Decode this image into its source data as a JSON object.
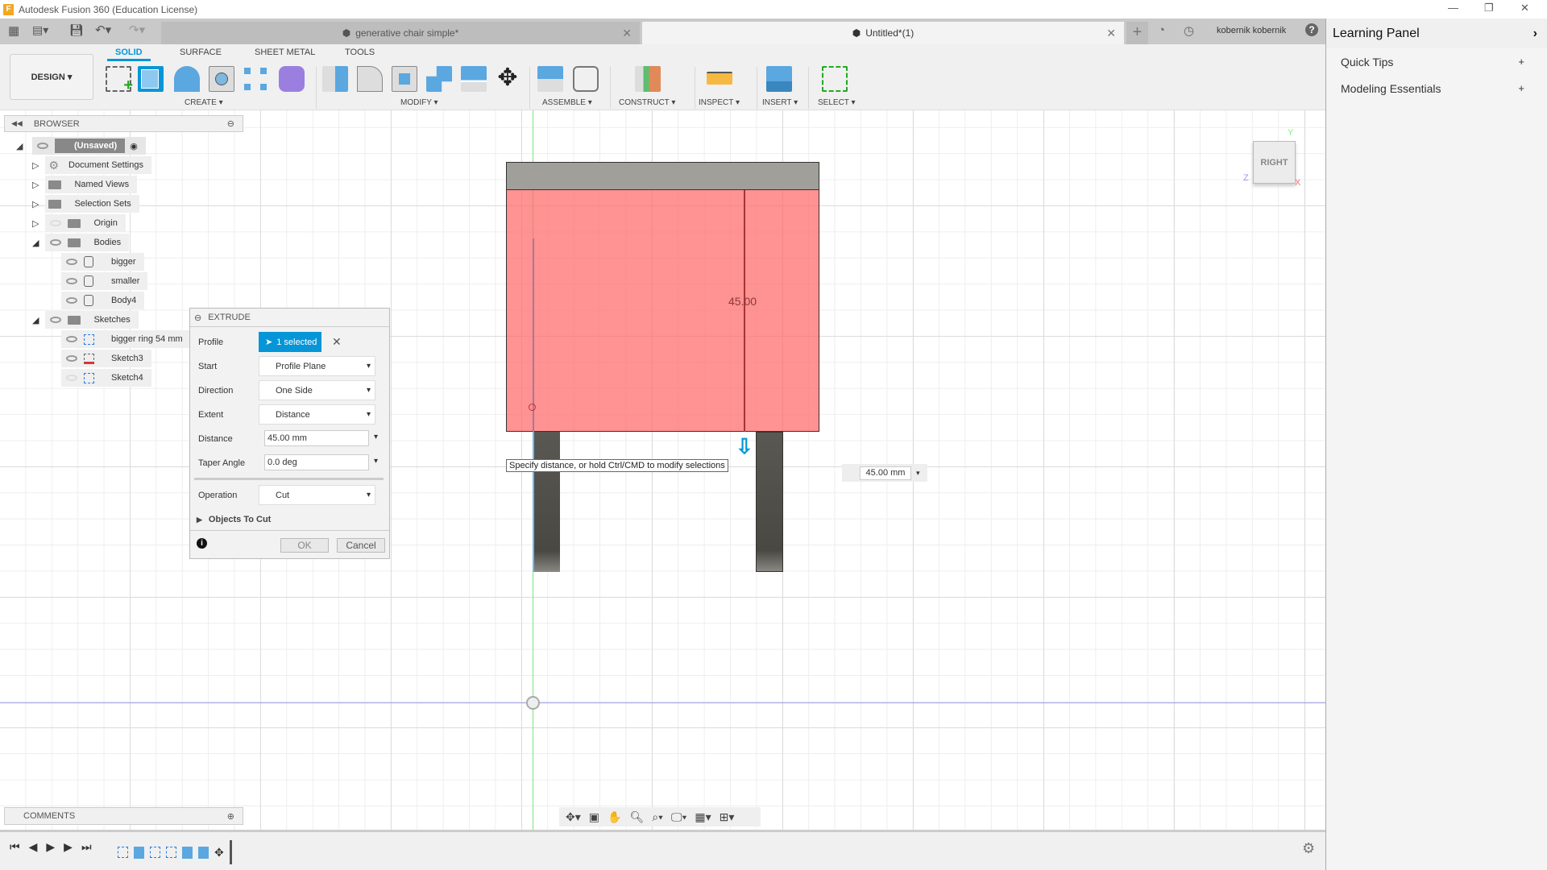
{
  "app": {
    "title": "Autodesk Fusion 360 (Education License)",
    "logo": "F"
  },
  "tabs": [
    {
      "label": "generative chair simple*",
      "active": false
    },
    {
      "label": "Untitled*(1)",
      "active": true
    }
  ],
  "user": {
    "name": "kobernik kobernik"
  },
  "toolbar": {
    "workspace": "DESIGN ▾",
    "tabs": [
      "SOLID",
      "SURFACE",
      "SHEET METAL",
      "TOOLS"
    ],
    "groups": [
      "CREATE ▾",
      "MODIFY ▾",
      "ASSEMBLE ▾",
      "CONSTRUCT ▾",
      "INSPECT ▾",
      "INSERT ▾",
      "SELECT ▾"
    ]
  },
  "browser": {
    "title": "BROWSER",
    "root": "(Unsaved)",
    "items": [
      "Document Settings",
      "Named Views",
      "Selection Sets",
      "Origin",
      "Bodies",
      "bigger",
      "smaller",
      "Body4",
      "Sketches",
      "bigger ring 54 mm",
      "Sketch3",
      "Sketch4"
    ]
  },
  "extrude": {
    "title": "EXTRUDE",
    "profile_label": "Profile",
    "profile_value": "1 selected",
    "start_label": "Start",
    "start_value": "Profile Plane",
    "direction_label": "Direction",
    "direction_value": "One Side",
    "extent_label": "Extent",
    "extent_value": "Distance",
    "distance_label": "Distance",
    "distance_value": "45.00 mm",
    "taper_label": "Taper Angle",
    "taper_value": "0.0 deg",
    "operation_label": "Operation",
    "operation_value": "Cut",
    "objects_to_cut": "Objects To Cut",
    "ok": "OK",
    "cancel": "Cancel"
  },
  "viewport": {
    "dimension_label": "45.00",
    "tooltip": "Specify distance, or hold Ctrl/CMD to modify selections",
    "distance_input": "45.00 mm",
    "viewcube": "RIGHT",
    "axes": {
      "y": "Y",
      "z": "Z",
      "x": "X"
    },
    "colors": {
      "profile": "#ff8a8a",
      "seat": "#a09f99",
      "legs": "#4f4c46",
      "accent": "#0696d7"
    }
  },
  "comments": {
    "title": "COMMENTS"
  },
  "learning": {
    "title": "Learning Panel",
    "items": [
      "Quick Tips",
      "Modeling Essentials"
    ],
    "expand": "+"
  }
}
